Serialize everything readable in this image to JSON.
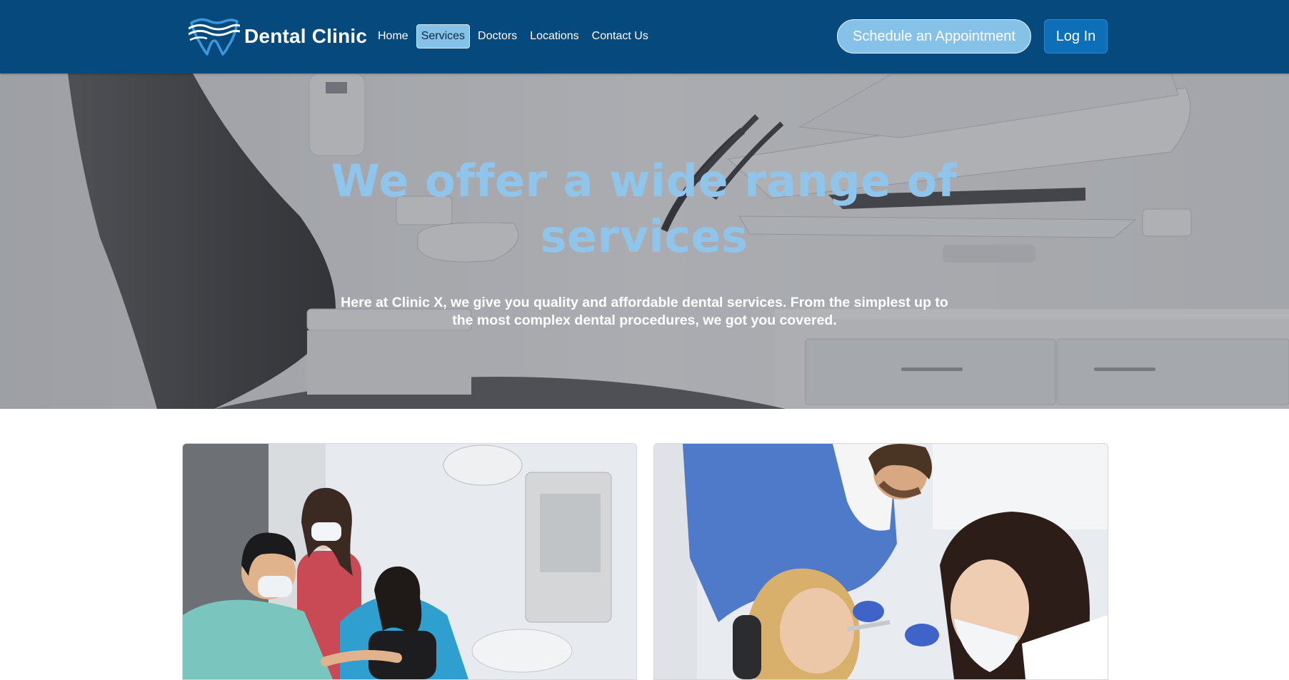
{
  "brand": {
    "name": "Dental Clinic",
    "logo_icon": "tooth-wave-icon",
    "color": "#06497c"
  },
  "nav": {
    "items": [
      {
        "label": "Home",
        "active": false
      },
      {
        "label": "Services",
        "active": true
      },
      {
        "label": "Doctors",
        "active": false
      },
      {
        "label": "Locations",
        "active": false
      },
      {
        "label": "Contact Us",
        "active": false
      }
    ]
  },
  "actions": {
    "appointment_label": "Schedule an Appointment",
    "login_label": "Log In"
  },
  "hero": {
    "title": "We offer a wide range of services",
    "subtitle": "Here at Clinic X, we give you quality and affordable dental services. From the simplest up to the most complex dental procedures, we got you covered.",
    "background": "dental-chair-photo",
    "title_color": "#8fc5ea"
  },
  "cards": [
    {
      "image": "dentist-team-with-patient-photo"
    },
    {
      "image": "dentist-treating-patient-photo"
    }
  ],
  "colors": {
    "navbar": "#06497c",
    "accent_light": "#86c2e8",
    "accent_button": "#0d6fb8"
  }
}
